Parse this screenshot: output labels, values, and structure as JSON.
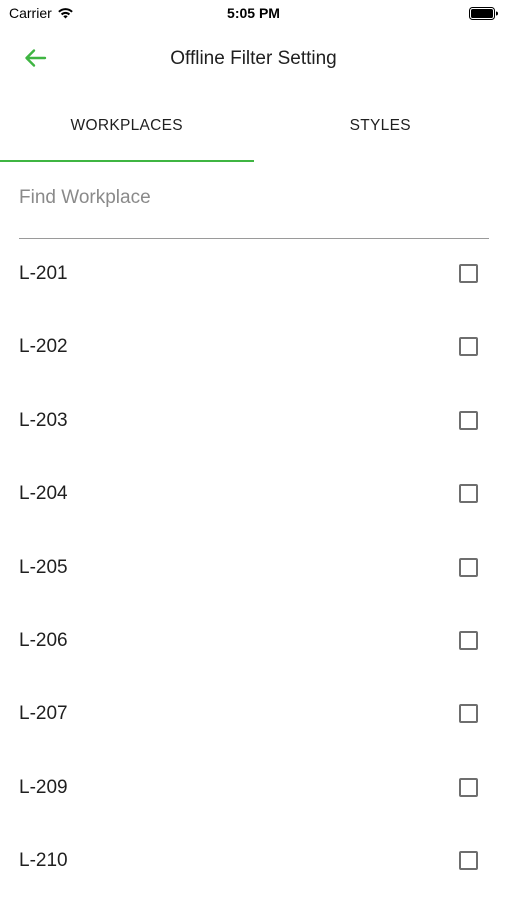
{
  "status_bar": {
    "carrier": "Carrier",
    "time": "5:05 PM",
    "icons": [
      "wifi-icon",
      "battery-icon"
    ]
  },
  "header": {
    "title": "Offline Filter Setting",
    "back_icon": "arrow-left-icon"
  },
  "tabs": [
    {
      "label": "WORKPLACES",
      "active": true
    },
    {
      "label": "STYLES",
      "active": false
    }
  ],
  "search": {
    "placeholder": "Find Workplace",
    "value": ""
  },
  "workplaces": [
    {
      "label": "L-201",
      "checked": false
    },
    {
      "label": "L-202",
      "checked": false
    },
    {
      "label": "L-203",
      "checked": false
    },
    {
      "label": "L-204",
      "checked": false
    },
    {
      "label": "L-205",
      "checked": false
    },
    {
      "label": "L-206",
      "checked": false
    },
    {
      "label": "L-207",
      "checked": false
    },
    {
      "label": "L-209",
      "checked": false
    },
    {
      "label": "L-210",
      "checked": false
    }
  ],
  "colors": {
    "accent": "#3fb542",
    "text": "#1f1f1f",
    "placeholder": "#8a8a8a",
    "checkbox_border": "#6e6e6e"
  }
}
